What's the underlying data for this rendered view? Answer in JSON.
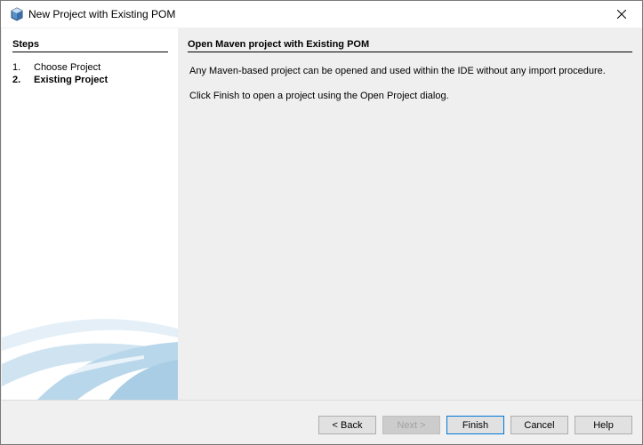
{
  "window": {
    "title": "New Project with Existing POM"
  },
  "steps": {
    "heading": "Steps",
    "items": [
      {
        "number": "1.",
        "label": "Choose Project",
        "current": false
      },
      {
        "number": "2.",
        "label": "Existing Project",
        "current": true
      }
    ]
  },
  "content": {
    "heading": "Open Maven project with Existing POM",
    "paragraph1": "Any Maven-based project can be opened and used within the IDE without any import procedure.",
    "paragraph2": "Click Finish to open a project using the Open Project dialog."
  },
  "buttons": {
    "back": "< Back",
    "next": "Next >",
    "finish": "Finish",
    "cancel": "Cancel",
    "help": "Help"
  },
  "icons": {
    "title": "netbeans-cube-icon",
    "close": "close-icon"
  },
  "colors": {
    "accent": "#0078d7",
    "swoosh": "#b9d7ea"
  }
}
